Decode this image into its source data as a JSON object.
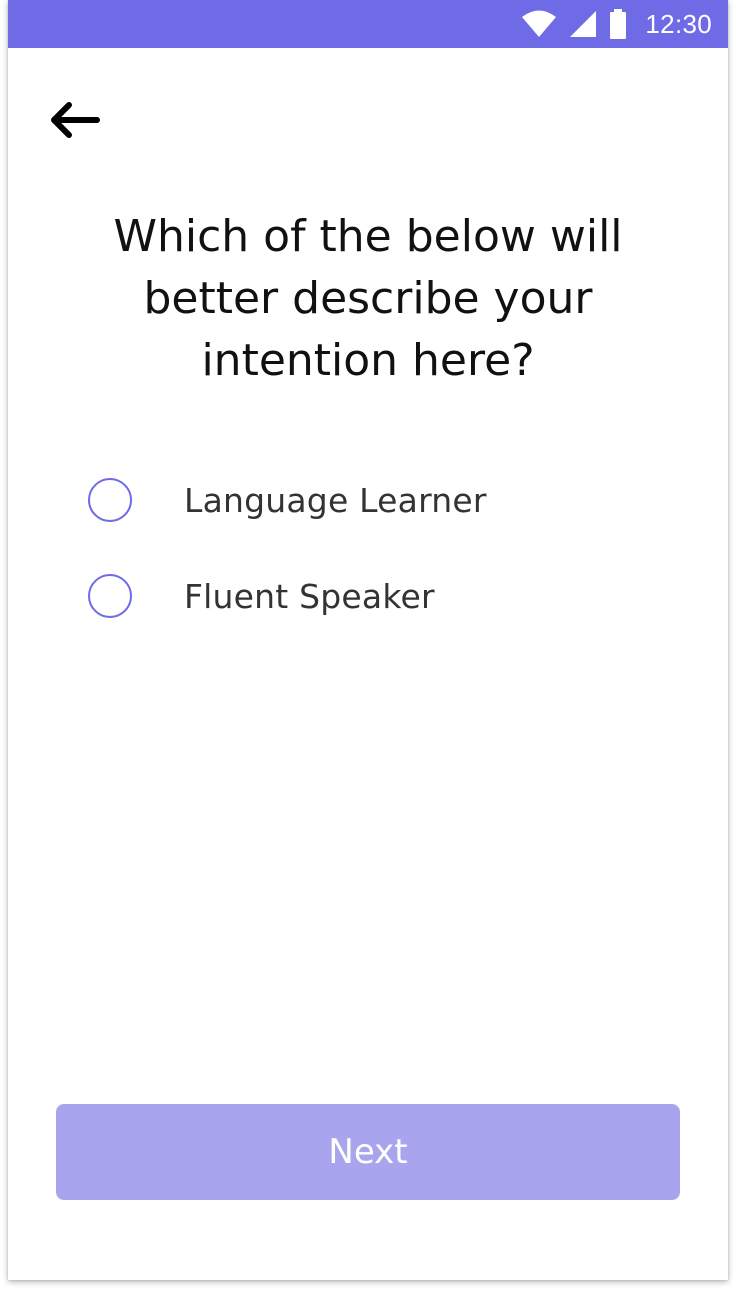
{
  "status_bar": {
    "time": "12:30",
    "icons": [
      "wifi-icon",
      "cellular-signal-icon",
      "battery-icon"
    ],
    "background_color": "#6f6be6"
  },
  "header": {
    "back_icon": "arrow-left-icon"
  },
  "question": {
    "line1": "Which of the below will",
    "line2": "better describe your",
    "line3": "intention here?"
  },
  "options": [
    {
      "label": "Language Learner",
      "selected": false
    },
    {
      "label": "Fluent Speaker",
      "selected": false
    }
  ],
  "footer": {
    "next_label": "Next",
    "button_color": "#a9a4ee",
    "enabled": false
  },
  "accent_color": "#6f6be6"
}
